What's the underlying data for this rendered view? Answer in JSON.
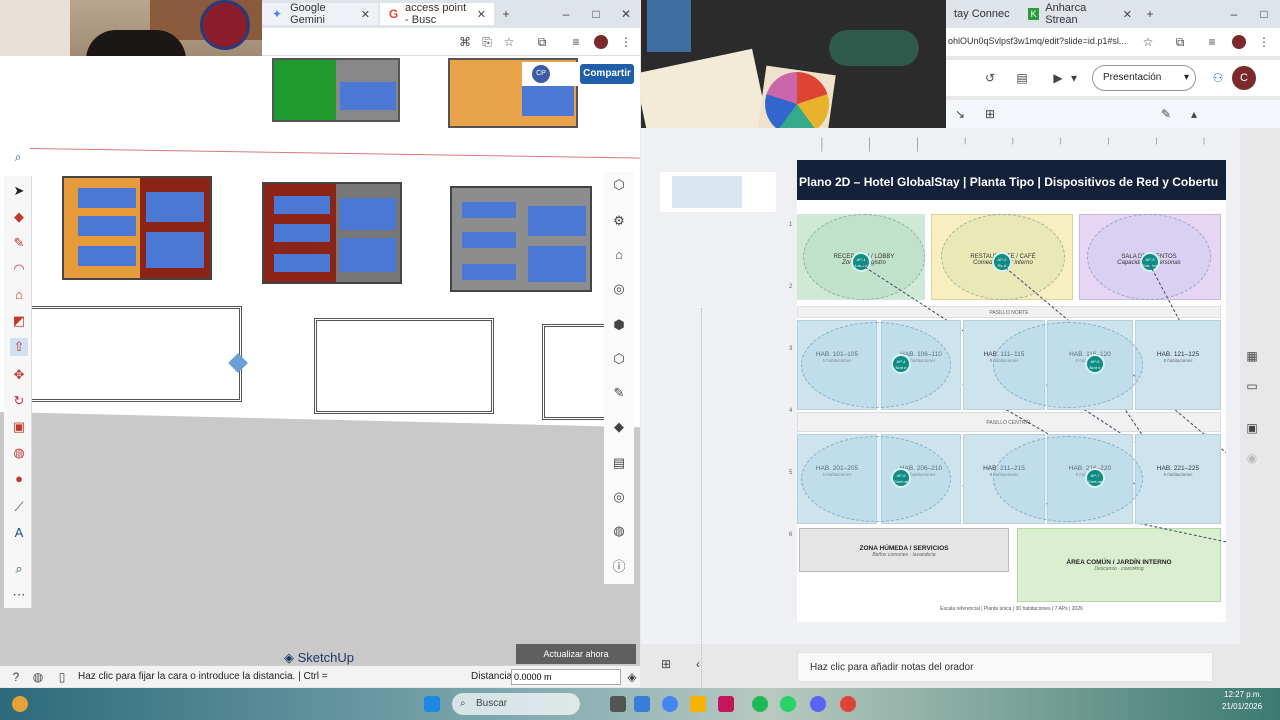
{
  "left_browser": {
    "tabs": [
      {
        "label": "Google Gemini"
      },
      {
        "label": "access point - Busc"
      }
    ]
  },
  "sketchup": {
    "share_button": "Compartir",
    "initials_badge": "CP",
    "update_button": "Actualizar ahora",
    "brand": "SketchUp",
    "status_hint": "Haz clic para fijar la cara o introduce la distancia. | Ctrl =",
    "distance_label": "Distancia",
    "distance_value": "0.0000 m"
  },
  "right_browser": {
    "tabs": [
      {
        "label": "tay Connec"
      },
      {
        "label": "Anharca Strean"
      }
    ],
    "url_fragment": "ohlOUn0qSvlpsf3w1mq/edit?slide=id.p1#sl...",
    "presentation_button": "Presentación",
    "avatar_initial": "C"
  },
  "slide": {
    "title": "Plano 2D – Hotel GlobalStay  |  Planta Tipo  |  Dispositivos de Red y Cobertu",
    "top_zones": [
      {
        "title": "RECEPCIÓN / LOBBY",
        "sub": "Zona de registro",
        "ap": "AP-1 Lobb y",
        "color": "#cfe9d6"
      },
      {
        "title": "RESTAURANTE / CAFÉ",
        "sub": "Comedor y bar interno",
        "ap": "AP-2 Rest",
        "color": "#f8efc1"
      },
      {
        "title": "SALA DE EVENTOS",
        "sub": "Capacidad 40 personas",
        "ap": "AP-3 Even tos",
        "color": "#e6d6f4"
      }
    ],
    "corridor_1": "PASILLO NORTE",
    "rooms_row_1": [
      {
        "title": "HAB. 101–105",
        "sub": "5 habitaciones"
      },
      {
        "title": "HAB. 106–110",
        "sub": "5 habitaciones"
      },
      {
        "title": "HAB. 111–115",
        "sub": "5 habitaciones"
      },
      {
        "title": "HAB. 116–120",
        "sub": "5 habitaciones"
      },
      {
        "title": "HAB. 121–125",
        "sub": "5 habitaciones"
      }
    ],
    "ap_row_1": [
      "AP-4 Nort e",
      "AP-5 Nort e"
    ],
    "corridor_2": "PASILLO CENTRAL",
    "rooms_row_2": [
      {
        "title": "HAB. 201–205",
        "sub": "5 habitaciones"
      },
      {
        "title": "HAB. 206–210",
        "sub": "5 habitaciones"
      },
      {
        "title": "HAB. 211–215",
        "sub": "5 habitaciones"
      },
      {
        "title": "HAB. 216–220",
        "sub": "5 habitaciones"
      },
      {
        "title": "HAB. 221–225",
        "sub": "5 habitaciones"
      }
    ],
    "ap_row_2": [
      "AP-6 Cent ral",
      "AP-7 Cent ral"
    ],
    "bottom_left": {
      "title": "ZONA HÚMEDA / SERVICIOS",
      "sub": "Baños comunes · lavanderia"
    },
    "bottom_right": {
      "title": "ÁREA COMÚN / JARDÍN INTERNO",
      "sub": "Descanso · coworking"
    },
    "footer": "Escala referencial  |  Planta única  |  30 habitaciones  |  7 APs  |  2026",
    "ruler_numbers": [
      "1",
      "2",
      "3",
      "4",
      "5",
      "6"
    ]
  },
  "notes_placeholder": "Haz clic para añadir notas del orador",
  "taskbar": {
    "search_label": "Buscar",
    "time": "12:27 p.m.",
    "date": "21/01/2026"
  }
}
